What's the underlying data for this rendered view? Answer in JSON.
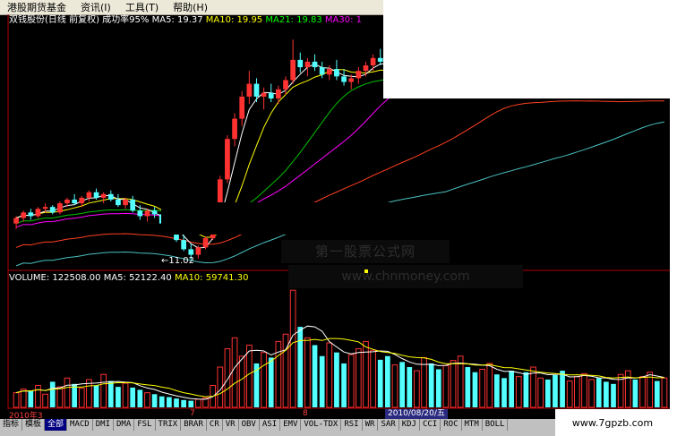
{
  "menu": [
    "港股期货基金",
    "资讯(I)",
    "工具(T)",
    "帮助(H)"
  ],
  "price_header": {
    "title": "双钱股份(日线 前复权)",
    "success_rate": "成功率95%",
    "ma5": "MA5: 19.37",
    "ma10": "MA10: 19.95",
    "ma21": "MA21: 19.83",
    "ma30": "MA30: 1"
  },
  "volume_header": {
    "volume": "VOLUME: 122508.00",
    "ma5": "MA5: 52122.40",
    "ma10": "MA10: 59741.30"
  },
  "low_label": "←11.02",
  "watermark": {
    "line1": "第一股票公式网",
    "line2": "www.chnmoney.com"
  },
  "date_axis": {
    "left": "2010年3",
    "mid": "7",
    "right": "8"
  },
  "cursor_date": "2010/08/20/五",
  "site": "www.7gpzb.com",
  "indicator_tabs": [
    "指标",
    "模板",
    "全部",
    "MACD",
    "DMI",
    "DMA",
    "FSL",
    "TRIX",
    "BRAR",
    "CR",
    "VR",
    "OBV",
    "ASI",
    "EMV",
    "VOL-TDX",
    "RSI",
    "WR",
    "SAR",
    "KDJ",
    "CCI",
    "ROC",
    "MTM",
    "BOLL"
  ],
  "active_tab": "全部",
  "colors": {
    "up": "#ff3232",
    "down": "#54ffff",
    "ma5": "#ffffff",
    "ma10": "#ffff00",
    "ma21": "#ff00ff",
    "ma30": "#00ff00",
    "ma60": "#00c000",
    "ma120": "#ff4020",
    "ma250": "#4ac0c0"
  },
  "chart_data": {
    "type": "candlestick",
    "title": "双钱股份(日线 前复权)",
    "price_range": [
      10.5,
      23.5
    ],
    "lowest_marked": 11.02,
    "candles": [
      [
        13.0,
        13.4,
        12.7,
        13.3
      ],
      [
        13.3,
        13.7,
        13.1,
        13.6
      ],
      [
        13.6,
        13.8,
        13.2,
        13.4
      ],
      [
        13.4,
        13.9,
        13.3,
        13.8
      ],
      [
        13.8,
        14.1,
        13.6,
        13.9
      ],
      [
        13.9,
        14.0,
        13.5,
        13.6
      ],
      [
        13.6,
        14.2,
        13.5,
        14.1
      ],
      [
        14.1,
        14.4,
        13.9,
        14.3
      ],
      [
        14.3,
        14.6,
        14.0,
        14.1
      ],
      [
        14.1,
        14.5,
        13.9,
        14.4
      ],
      [
        14.4,
        14.8,
        14.2,
        14.7
      ],
      [
        14.7,
        14.9,
        14.3,
        14.4
      ],
      [
        14.4,
        14.7,
        14.1,
        14.6
      ],
      [
        14.6,
        14.8,
        14.2,
        14.3
      ],
      [
        14.3,
        14.6,
        13.9,
        14.0
      ],
      [
        14.0,
        14.4,
        13.8,
        14.3
      ],
      [
        14.3,
        14.5,
        13.6,
        13.7
      ],
      [
        13.7,
        14.0,
        13.2,
        13.4
      ],
      [
        13.4,
        13.8,
        13.1,
        13.7
      ],
      [
        13.7,
        13.9,
        13.3,
        13.5
      ],
      [
        13.5,
        13.7,
        12.9,
        13.0
      ],
      [
        13.0,
        13.3,
        12.5,
        12.6
      ],
      [
        12.6,
        12.9,
        12.0,
        12.1
      ],
      [
        12.1,
        12.4,
        11.5,
        11.6
      ],
      [
        11.6,
        11.9,
        11.02,
        11.3
      ],
      [
        11.3,
        11.8,
        11.1,
        11.7
      ],
      [
        11.7,
        12.3,
        11.6,
        12.2
      ],
      [
        12.2,
        13.8,
        12.1,
        13.6
      ],
      [
        13.6,
        15.6,
        13.5,
        15.4
      ],
      [
        15.4,
        17.8,
        15.2,
        17.6
      ],
      [
        17.6,
        19.0,
        17.2,
        18.7
      ],
      [
        18.7,
        20.2,
        18.3,
        19.9
      ],
      [
        19.9,
        21.3,
        19.5,
        20.6
      ],
      [
        20.6,
        20.9,
        19.6,
        19.9
      ],
      [
        19.9,
        20.4,
        19.2,
        20.1
      ],
      [
        20.1,
        20.6,
        19.6,
        19.8
      ],
      [
        19.8,
        20.5,
        19.5,
        20.3
      ],
      [
        20.3,
        21.0,
        20.0,
        20.8
      ],
      [
        20.8,
        23.0,
        20.6,
        21.9
      ],
      [
        21.9,
        22.3,
        21.2,
        21.5
      ],
      [
        21.5,
        22.0,
        21.0,
        21.8
      ],
      [
        21.8,
        22.2,
        21.3,
        21.5
      ],
      [
        21.5,
        21.8,
        20.9,
        21.1
      ],
      [
        21.1,
        21.6,
        20.8,
        21.4
      ],
      [
        21.4,
        21.9,
        20.8,
        21.0
      ],
      [
        21.0,
        21.4,
        20.5,
        20.7
      ],
      [
        20.7,
        21.1,
        20.3,
        20.9
      ],
      [
        20.9,
        21.5,
        20.6,
        21.3
      ],
      [
        21.3,
        21.8,
        21.0,
        21.6
      ],
      [
        21.6,
        22.2,
        21.3,
        22.0
      ],
      [
        22.0,
        22.5,
        21.6,
        21.8
      ],
      [
        21.8,
        22.1,
        21.2,
        21.4
      ],
      [
        21.4,
        21.9,
        21.0,
        21.7
      ],
      [
        21.7,
        22.0,
        21.1,
        21.3
      ],
      [
        21.3,
        21.6,
        20.7,
        20.9
      ],
      [
        20.9,
        21.4,
        20.6,
        21.2
      ],
      [
        21.2,
        21.7,
        20.9,
        21.5
      ],
      [
        21.5,
        21.9,
        21.0,
        21.2
      ],
      [
        21.2,
        21.6,
        20.6,
        20.8
      ],
      [
        20.8,
        21.3,
        20.5,
        21.1
      ],
      [
        21.1,
        21.8,
        20.9,
        21.6
      ],
      [
        21.6,
        22.1,
        21.3,
        21.9
      ],
      [
        21.9,
        22.3,
        21.4,
        21.6
      ],
      [
        21.6,
        21.9,
        21.0,
        21.2
      ],
      [
        21.2,
        21.6,
        20.8,
        21.4
      ],
      [
        21.4,
        21.9,
        21.1,
        21.7
      ],
      [
        21.7,
        22.0,
        21.2,
        21.4
      ],
      [
        21.4,
        21.7,
        20.8,
        21.0
      ],
      [
        21.0,
        21.3,
        20.5,
        20.7
      ],
      [
        20.7,
        21.2,
        20.4,
        21.0
      ],
      [
        21.0,
        21.4,
        20.6,
        20.9
      ],
      [
        20.9,
        21.3,
        20.5,
        21.1
      ],
      [
        21.1,
        21.6,
        20.8,
        21.4
      ],
      [
        21.4,
        21.8,
        21.0,
        21.2
      ],
      [
        21.2,
        21.5,
        20.7,
        20.9
      ],
      [
        20.9,
        21.3,
        20.4,
        20.6
      ],
      [
        20.6,
        21.0,
        20.3,
        20.8
      ],
      [
        20.8,
        21.2,
        20.5,
        21.0
      ],
      [
        21.0,
        21.5,
        20.7,
        21.3
      ],
      [
        21.3,
        21.8,
        21.0,
        21.6
      ],
      [
        21.6,
        22.0,
        21.2,
        21.4
      ],
      [
        21.4,
        21.7,
        20.9,
        21.1
      ],
      [
        21.1,
        21.4,
        20.6,
        20.8
      ],
      [
        20.8,
        21.2,
        20.5,
        21.0
      ],
      [
        21.0,
        21.5,
        20.8,
        21.3
      ],
      [
        21.3,
        21.7,
        21.0,
        21.1
      ],
      [
        21.1,
        21.5,
        20.8,
        21.4
      ],
      [
        21.4,
        21.9,
        21.2,
        21.7
      ],
      [
        21.7,
        22.1,
        21.4,
        21.6
      ],
      [
        21.6,
        22.0,
        21.2,
        21.9
      ]
    ],
    "volumes": [
      20,
      25,
      22,
      30,
      18,
      35,
      28,
      40,
      32,
      26,
      38,
      30,
      45,
      36,
      28,
      33,
      27,
      24,
      20,
      18,
      15,
      14,
      12,
      10,
      9,
      11,
      13,
      30,
      55,
      80,
      95,
      70,
      85,
      60,
      75,
      68,
      90,
      100,
      160,
      110,
      95,
      85,
      70,
      88,
      75,
      60,
      72,
      80,
      90,
      78,
      65,
      70,
      58,
      62,
      55,
      50,
      68,
      60,
      52,
      57,
      64,
      70,
      55,
      48,
      52,
      60,
      45,
      40,
      50,
      42,
      48,
      55,
      40,
      38,
      44,
      50,
      36,
      42,
      46,
      38,
      40,
      35,
      32,
      45,
      50,
      38,
      42,
      48,
      36,
      40
    ],
    "volume_range": [
      0,
      170000
    ]
  }
}
